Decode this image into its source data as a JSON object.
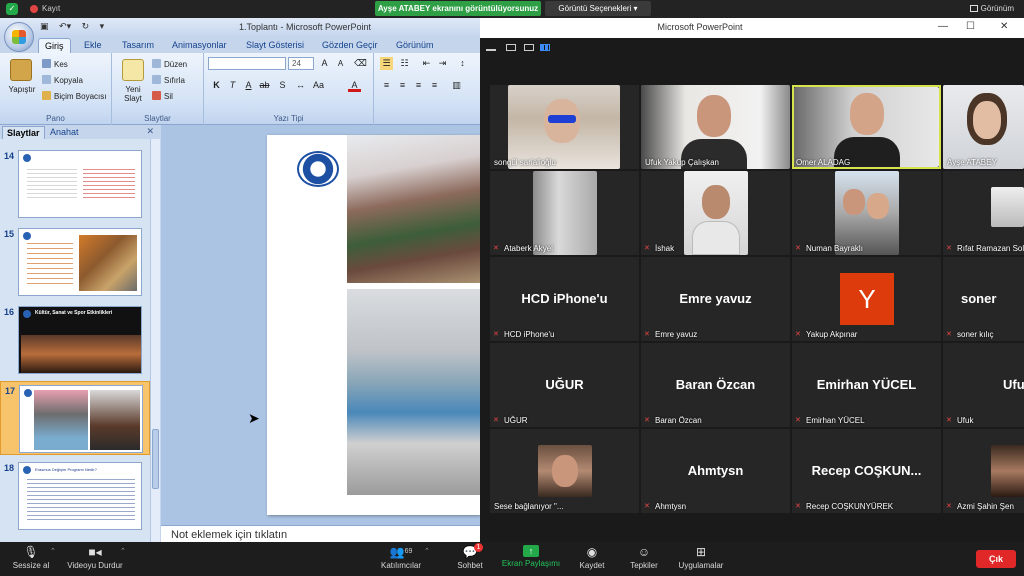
{
  "zoom_top": {
    "record_label": "Kayıt",
    "share_banner": "Ayşe ATABEY ekranını görüntülüyorsunuz",
    "view_options": "Görüntü Seçenekleri ▾",
    "view_label": "Görünüm"
  },
  "ppt": {
    "title": "1.Toplantı  -  Microsoft PowerPoint",
    "tabs": [
      "Giriş",
      "Ekle",
      "Tasarım",
      "Animasyonlar",
      "Slayt Gösterisi",
      "Gözden Geçir",
      "Görünüm"
    ],
    "ribbon": {
      "clipboard": {
        "paste": "Yapıştır",
        "cut": "Kes",
        "copy": "Kopyala",
        "format_painter": "Biçim Boyacısı",
        "group": "Pano"
      },
      "slides": {
        "new_slide": "Yeni Slayt",
        "layout": "Düzen",
        "reset": "Sıfırla",
        "delete": "Sil",
        "group": "Slaytlar"
      },
      "font": {
        "size": "24",
        "group": "Yazı Tipi"
      }
    },
    "side_tabs": [
      "Slaytlar",
      "Anahat"
    ],
    "slide_numbers": [
      "14",
      "15",
      "16",
      "17",
      "18"
    ],
    "notes_placeholder": "Not eklemek için tıklatın",
    "thumb16_title": "Kültür, Sanat ve Spor Etkinlikleri",
    "thumb18_title": "Erasmus Değişim Programı Nedir?"
  },
  "gallery": {
    "title": "Microsoft PowerPoint",
    "participants": [
      {
        "name": "songül sarialioğlu",
        "muted": false,
        "video": true
      },
      {
        "name": "Ufuk Yakup Çalışkan",
        "muted": false,
        "video": true
      },
      {
        "name": "Omer ALADAG",
        "muted": false,
        "video": true,
        "active": true
      },
      {
        "name": "Ayşe ATABEY",
        "muted": false,
        "video": true
      },
      {
        "name": "Ataberk Akyel",
        "muted": true,
        "video": true
      },
      {
        "name": "İshak",
        "muted": true,
        "video": true
      },
      {
        "name": "Numan Bayraklı",
        "muted": true,
        "video": true
      },
      {
        "name": "Rıfat Ramazan Sol",
        "muted": true,
        "video": true
      },
      {
        "name": "HCD iPhone'u",
        "display": "HCD iPhone'u",
        "muted": true,
        "video": false
      },
      {
        "name": "Emre yavuz",
        "display": "Emre yavuz",
        "muted": true,
        "video": false
      },
      {
        "name": "Yakup Akpınar",
        "avatar": "Y",
        "muted": true,
        "video": false
      },
      {
        "name": "soner kılıç",
        "display": "soner",
        "muted": true,
        "video": false
      },
      {
        "name": "UĞUR",
        "display": "UĞUR",
        "muted": true,
        "video": false
      },
      {
        "name": "Baran Özcan",
        "display": "Baran Özcan",
        "muted": true,
        "video": false
      },
      {
        "name": "Emirhan YÜCEL",
        "display": "Emirhan YÜCEL",
        "muted": true,
        "video": false
      },
      {
        "name": "Ufuk",
        "display": "Ufu",
        "muted": true,
        "video": false
      },
      {
        "name": "Sese bağlanıyor \"...",
        "muted": false,
        "video": true
      },
      {
        "name": "Ahmtysn",
        "display": "Ahmtysn",
        "muted": true,
        "video": false
      },
      {
        "name": "Recep COŞKUNYÜREK",
        "display": "Recep  COŞKUN...",
        "muted": true,
        "video": false
      },
      {
        "name": "Azmi Şahin Şen",
        "muted": true,
        "video": true
      }
    ]
  },
  "zoom_bottom": {
    "mute": "Sessize al",
    "video": "Videoyu Durdur",
    "participants": "Katılımcılar",
    "participants_count": "69",
    "chat": "Sohbet",
    "chat_badge": "1",
    "share": "Ekran Paylaşımı",
    "record": "Kaydet",
    "reactions": "Tepkiler",
    "apps": "Uygulamalar",
    "leave": "Çık"
  }
}
